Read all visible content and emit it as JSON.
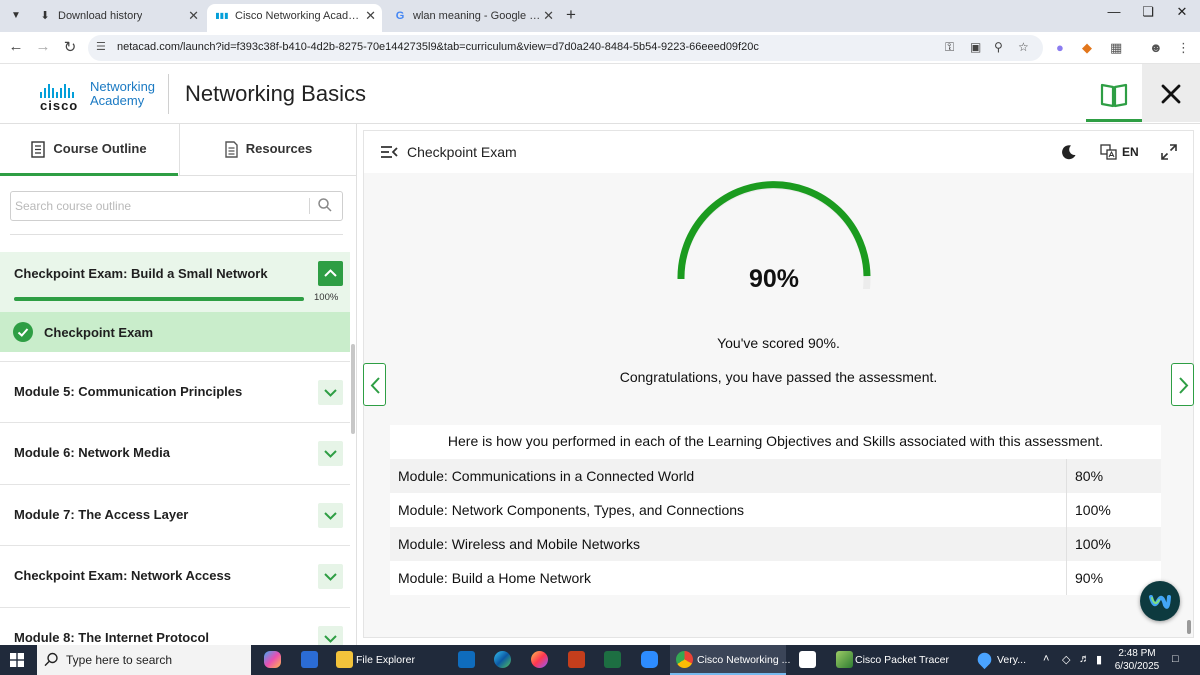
{
  "browser": {
    "tabs": [
      {
        "title": "Download history",
        "icon": "download-icon"
      },
      {
        "title": "Cisco Networking Academy: Co",
        "icon": "cisco-icon"
      },
      {
        "title": "wlan meaning - Google Search",
        "icon": "google-icon"
      }
    ],
    "url": "netacad.com/launch?id=f393c38f-b410-4d2b-8275-70e1442735l9&tab=curriculum&view=d7d0a240-8484-5b54-9223-66eeed09f20c"
  },
  "app": {
    "logo_brand": "cisco",
    "logo_line1": "Networking",
    "logo_line2": "Academy",
    "title": "Networking Basics"
  },
  "sidebar": {
    "tab_outline": "Course Outline",
    "tab_resources": "Resources",
    "search_placeholder": "Search course outline",
    "section": {
      "title": "Checkpoint Exam: Build a Small Network",
      "progress_label": "100%",
      "progress": 1.0
    },
    "active_item": "Checkpoint Exam",
    "modules": [
      "Module 5: Communication Principles",
      "Module 6: Network Media",
      "Module 7: The Access Layer",
      "Checkpoint Exam: Network Access",
      "Module 8: The Internet Protocol"
    ]
  },
  "content": {
    "title": "Checkpoint Exam",
    "language": "EN",
    "score_label": "90%",
    "score": 0.9,
    "score_msg": "You've scored 90%.",
    "congrats_msg": "Congratulations, you have passed the assessment.",
    "performance_header": "Here is how you performed in each of the Learning Objectives and Skills associated with this assessment.",
    "performance": [
      {
        "name": "Module: Communications in a Connected World",
        "value": "80%"
      },
      {
        "name": "Module: Network Components, Types, and Connections",
        "value": "100%"
      },
      {
        "name": "Module: Wireless and Mobile Networks",
        "value": "100%"
      },
      {
        "name": "Module: Build a Home Network",
        "value": "90%"
      }
    ]
  },
  "taskbar": {
    "search_placeholder": "Type here to search",
    "file_explorer": "File Explorer",
    "chrome": "Cisco Networking ...",
    "packet_tracer": "Cisco Packet Tracer",
    "weather": "Very...",
    "time": "2:48 PM",
    "date": "6/30/2025"
  },
  "colors": {
    "accent": "#2e9e44",
    "section_bg": "#e9f6ea",
    "active_item_bg": "#c9edcb",
    "taskbar": "#202a3b"
  }
}
